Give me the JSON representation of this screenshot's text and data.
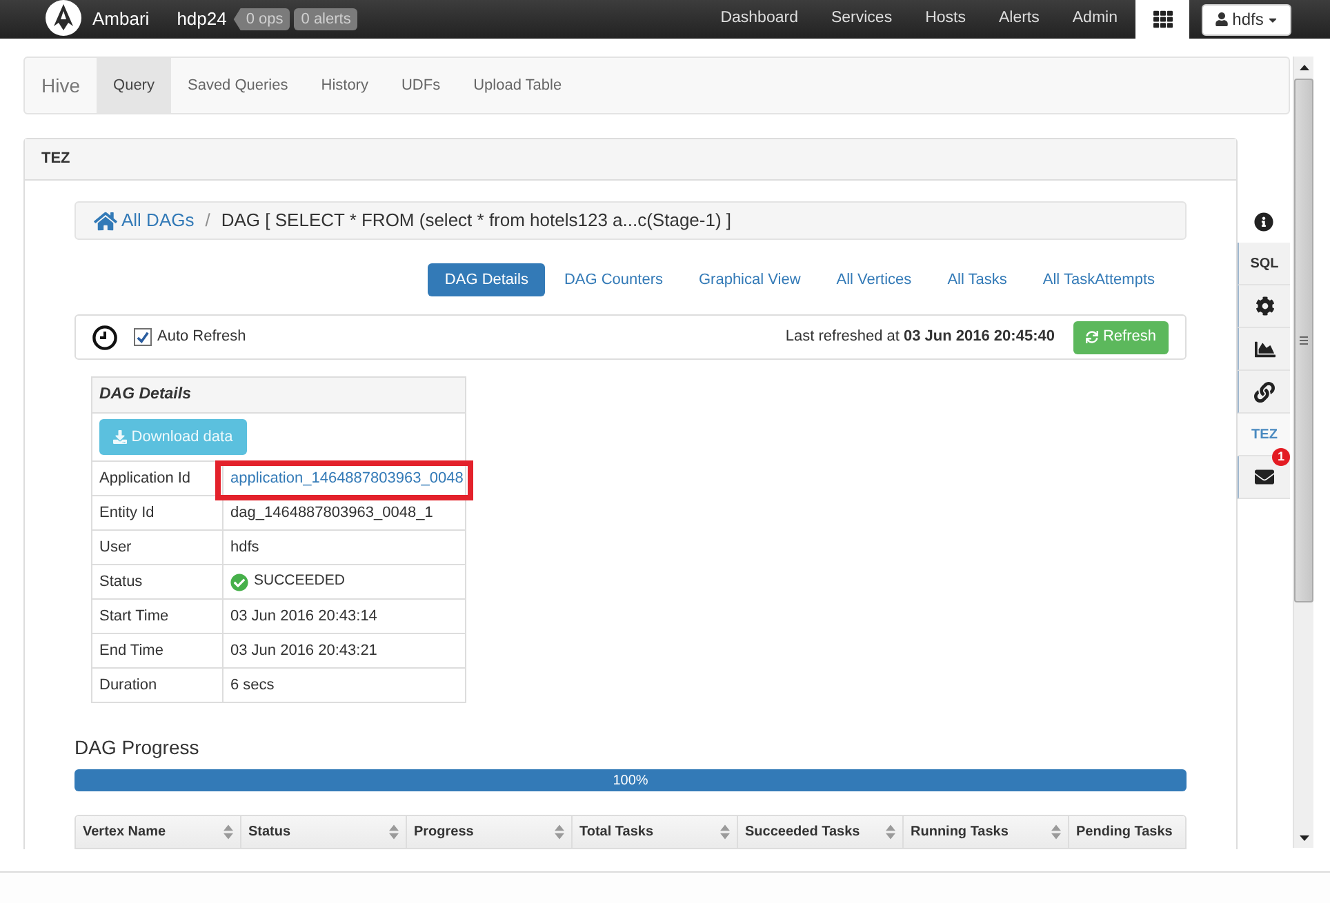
{
  "navbar": {
    "brand": "Ambari",
    "cluster": "hdp24",
    "badges": [
      "0 ops",
      "0 alerts"
    ],
    "links": [
      "Dashboard",
      "Services",
      "Hosts",
      "Alerts",
      "Admin"
    ],
    "user": "hdfs"
  },
  "view_tabs": {
    "title": "Hive",
    "tabs": [
      {
        "label": "Query",
        "selected": true
      },
      {
        "label": "Saved Queries",
        "selected": false
      },
      {
        "label": "History",
        "selected": false
      },
      {
        "label": "UDFs",
        "selected": false
      },
      {
        "label": "Upload Table",
        "selected": false
      }
    ]
  },
  "panel": {
    "title": "TEZ"
  },
  "breadcrumb": {
    "root": "All DAGs",
    "separator": "/",
    "current": "DAG [ SELECT * FROM (select * from hotels123 a...c(Stage-1) ]"
  },
  "tabs": [
    {
      "label": "DAG Details",
      "selected": true
    },
    {
      "label": "DAG Counters",
      "selected": false
    },
    {
      "label": "Graphical View",
      "selected": false
    },
    {
      "label": "All Vertices",
      "selected": false
    },
    {
      "label": "All Tasks",
      "selected": false
    },
    {
      "label": "All TaskAttempts",
      "selected": false
    }
  ],
  "refresh_bar": {
    "auto_refresh": {
      "label": "Auto Refresh",
      "checked": true
    },
    "last_refreshed": "Last refreshed at **03 Jun 2016 20:45:40**",
    "button": "Refresh"
  },
  "details": {
    "title": "DAG Details",
    "download_button": "Download data",
    "rows": [
      {
        "label": "Application Id",
        "value": "application_1464887803963_0048",
        "kind": "link",
        "highlighted": true
      },
      {
        "label": "Entity Id",
        "value": "dag_1464887803963_0048_1",
        "kind": "text",
        "highlighted": false
      },
      {
        "label": "User",
        "value": "hdfs",
        "kind": "text",
        "highlighted": false
      },
      {
        "label": "Status",
        "value": "SUCCEEDED",
        "kind": "status",
        "highlighted": false
      },
      {
        "label": "Start Time",
        "value": "03 Jun 2016 20:43:14",
        "kind": "text",
        "highlighted": false
      },
      {
        "label": "End Time",
        "value": "03 Jun 2016 20:43:21",
        "kind": "text",
        "highlighted": false
      },
      {
        "label": "Duration",
        "value": "6 secs",
        "kind": "text",
        "highlighted": false
      }
    ]
  },
  "progress": {
    "title": "DAG Progress",
    "level": 1,
    "reading": "100%"
  },
  "vertex_table": {
    "columns": [
      {
        "label": "Vertex Name",
        "sortable": true
      },
      {
        "label": "Status",
        "sortable": true
      },
      {
        "label": "Progress",
        "sortable": true
      },
      {
        "label": "Total Tasks",
        "sortable": true
      },
      {
        "label": "Succeeded Tasks",
        "sortable": true
      },
      {
        "label": "Running Tasks",
        "sortable": true
      },
      {
        "label": "Pending Tasks",
        "sortable": false
      }
    ]
  },
  "side_toolbar": {
    "items": [
      {
        "kind": "info",
        "selected": false
      },
      {
        "kind": "text",
        "label": "SQL",
        "selected": false
      },
      {
        "kind": "settings",
        "selected": false
      },
      {
        "kind": "chart",
        "selected": false
      },
      {
        "kind": "link",
        "selected": false
      },
      {
        "kind": "text",
        "label": "TEZ",
        "selected": true
      },
      {
        "kind": "mail",
        "badge": "1",
        "selected": false
      }
    ]
  }
}
